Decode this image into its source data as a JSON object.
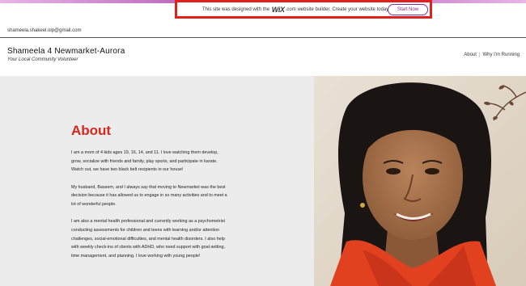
{
  "wix_banner": {
    "text_before": "This site was designed with the",
    "logo": "WiX",
    "logo_suffix": ".com",
    "text_after": "website builder. Create your website today.",
    "cta": "Start Now"
  },
  "header": {
    "email": "shameela.shakeel.olp@gmail.com",
    "site_title": "Shameela 4 Newmarket-Aurora",
    "tagline": "Your Local Community Volunteer"
  },
  "nav": {
    "items": [
      {
        "label": "About"
      },
      {
        "label": "Why I'm Running"
      }
    ]
  },
  "about": {
    "title": "About",
    "paragraphs": [
      "I am a mom of 4 kids ages 19, 16, 14, and 11. I love watching them develop, grow, socialize with friends and family, play sports, and participate in karate. Watch out, we have two black belt recipients in our house!",
      "My husband, Bassem, and I always say that moving to Newmarket was the best decision because it has allowed us to engage in so many activities and to meet a lot of wonderful people.",
      "I am also a mental health professional and currently working as a psychometrist conducting assessments for children and teens with learning and/or attention challenges, social-emotional difficulties, and mental health disorders. I also help with weekly check-ins of clients with ADHD, who need support with goal-setting, time management, and planning. I love working with young people!"
    ]
  },
  "colors": {
    "accent_red": "#d9261c",
    "wix_purple": "#8a2c8a",
    "highlight_box": "#e0201c",
    "panel_gray": "#ececec"
  }
}
